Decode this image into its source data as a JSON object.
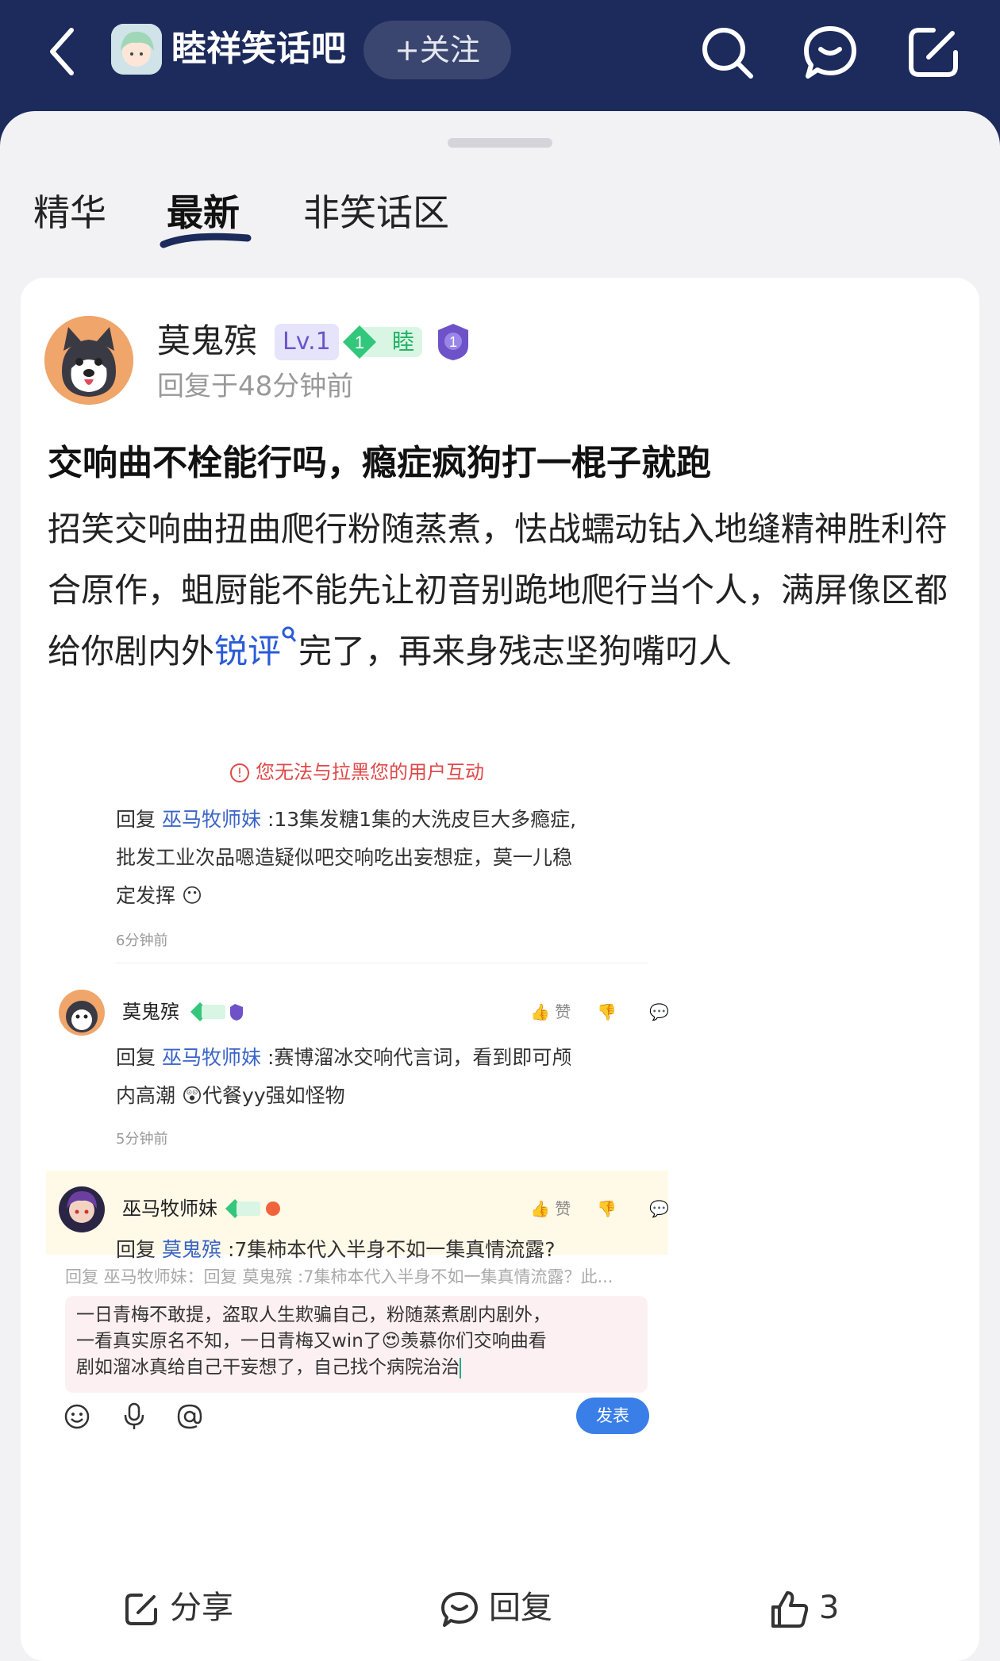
{
  "topbar": {
    "forum_name": "睦祥笑话吧",
    "follow_label": "+关注"
  },
  "tabs": [
    {
      "label": "精华"
    },
    {
      "label": "最新",
      "active": true
    },
    {
      "label": "非笑话区"
    }
  ],
  "post": {
    "username": "莫鬼殡",
    "level": "Lv.1",
    "fan_level": "1",
    "fan_tag": "睦",
    "medal_number": "1",
    "time": "回复于48分钟前",
    "title": "交响曲不栓能行吗，瘾症疯狗打一棍子就跑",
    "content_before": "招笑交响曲扭曲爬行粉随蒸煮，怯战蠕动钻入地缝精神胜利符合原作，蛆厨能不能先让初音别跪地爬行当个人，满屏像区都给你剧内外",
    "content_link": "锐评",
    "content_after": "完了，再来身残志坚狗嘴叼人"
  },
  "screenshot": {
    "warning": "您无法与拉黑您的用户互动",
    "reply1_prefix": "回复",
    "reply1_mention": "巫马牧师妹",
    "reply1_line1": ":13集发糖1集的大洗皮巨大多瘾症,",
    "reply1_line2": "批发工业次品嗯造疑似吧交响吃出妄想症，莫一儿稳",
    "reply1_line3": "定发挥",
    "reply1_time": "6分钟前",
    "c2_name": "莫鬼殡",
    "c2_like": "赞",
    "reply2_prefix": "回复",
    "reply2_mention": "巫马牧师妹",
    "reply2_line1": ":赛博溜冰交响代言词，看到即可颅",
    "reply2_line2": "内高潮",
    "reply2_line2b": "代餐yy强如怪物",
    "reply2_time": "5分钟前",
    "c3_name": "巫马牧师妹",
    "c3_like": "赞",
    "reply3_prefix": "回复",
    "reply3_mention": "莫鬼殡",
    "reply3_text": ":7集柿本代入半身不如一集真情流露?",
    "quote": "回复 巫马牧师妹：回复 莫鬼殡 :7集柿本代入半身不如一集真情流露？此...",
    "draft_line1": "一日青梅不敢提，盗取人生欺骗自己，粉随蒸煮剧内剧外，",
    "draft_line2a": "一看真实原名不知，一日青梅又win了",
    "draft_line2b": "羡慕你们交响曲看",
    "draft_line3": "剧如溜冰真给自己干妄想了，自己找个病院治治",
    "send_label": "发表"
  },
  "actions": {
    "share_label": "分享",
    "reply_label": "回复",
    "like_count": "3"
  },
  "colors": {
    "topbar": "#1c2a5c",
    "link": "#2a5bd7",
    "fan_green": "#21b264",
    "send_blue": "#3a7ee8"
  }
}
